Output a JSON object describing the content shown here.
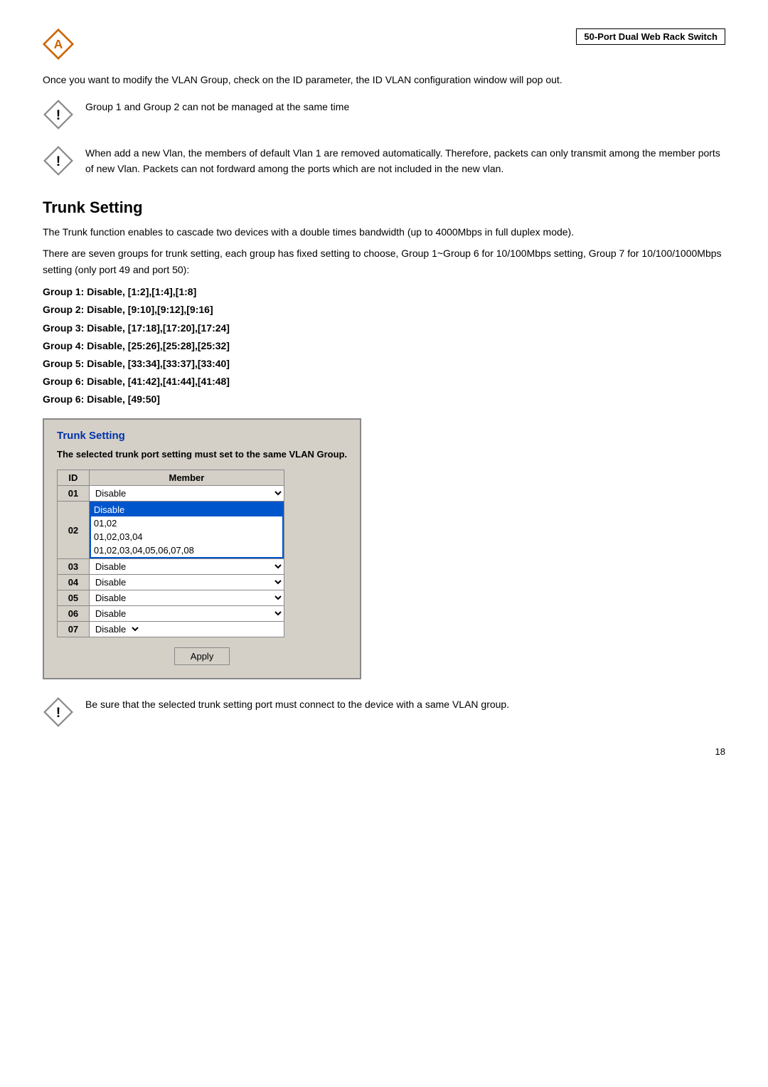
{
  "header": {
    "product_label": "50-Port Dual Web Rack Switch"
  },
  "intro": {
    "text": "Once you want to modify the VLAN Group, check on the ID parameter, the ID VLAN configuration window will pop out."
  },
  "warnings": [
    {
      "id": "w1",
      "text": "Group 1 and Group 2 can not be managed at the same time"
    },
    {
      "id": "w2",
      "text": "When add a new Vlan, the members of default Vlan 1 are removed automatically. Therefore, packets can only transmit among the member ports of new Vlan. Packets can not fordward among the ports which are not included in the new vlan."
    }
  ],
  "trunk_section": {
    "title": "Trunk Setting",
    "desc1": "The Trunk function enables to cascade two devices with a double times bandwidth (up to 4000Mbps in full duplex mode).",
    "desc2": "There are seven groups for trunk setting, each group has fixed setting to choose, Group 1~Group 6 for 10/100Mbps setting, Group 7 for 10/100/1000Mbps setting (only port 49 and port 50):",
    "groups": [
      "Group 1: Disable, [1:2],[1:4],[1:8]",
      "Group 2: Disable, [9:10],[9:12],[9:16]",
      "Group 3: Disable, [17:18],[17:20],[17:24]",
      "Group 4: Disable, [25:26],[25:28],[25:32]",
      "Group 5: Disable, [33:34],[33:37],[33:40]",
      "Group 6: Disable, [41:42],[41:44],[41:48]",
      "Group 6: Disable, [49:50]"
    ]
  },
  "trunk_panel": {
    "title": "Trunk Setting",
    "note": "The selected trunk port setting must set to the same VLAN Group.",
    "col_id": "ID",
    "col_member": "Member",
    "rows": [
      {
        "id": "01",
        "value": "Disable",
        "type": "select"
      },
      {
        "id": "02",
        "value": "Disable",
        "type": "open",
        "options": [
          "Disable",
          "01,02",
          "01,02,03,04",
          "01,02,03,04,05,06,07,08"
        ]
      },
      {
        "id": "03",
        "value": "Disable",
        "type": "select"
      },
      {
        "id": "04",
        "value": "Disable",
        "type": "select"
      },
      {
        "id": "05",
        "value": "Disable",
        "type": "select"
      },
      {
        "id": "06",
        "value": "Disable",
        "type": "select"
      },
      {
        "id": "07",
        "value": "Disable",
        "type": "select-small"
      }
    ],
    "apply_label": "Apply"
  },
  "bottom_warning": {
    "text": "Be sure that the selected trunk setting port must connect to the device with a same VLAN group."
  },
  "page_number": "18"
}
